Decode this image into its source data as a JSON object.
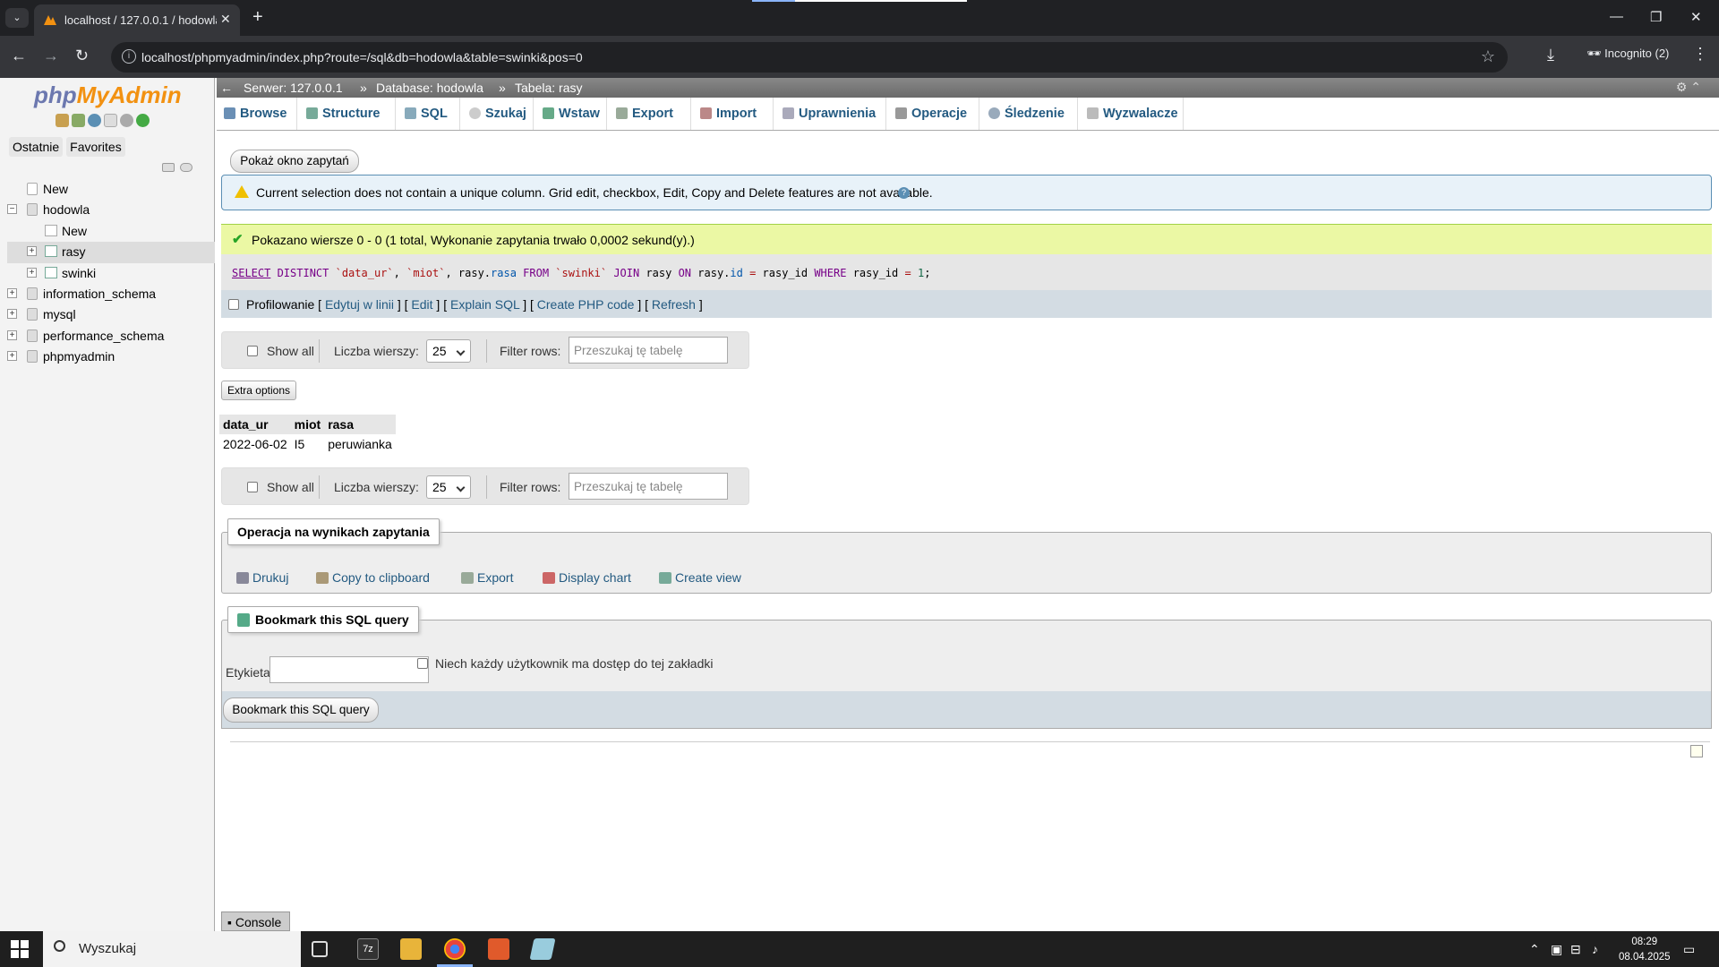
{
  "browser": {
    "tab_title": "localhost / 127.0.0.1 / hodowla",
    "url": "localhost/phpmyadmin/index.php?route=/sql&db=hodowla&table=swinki&pos=0",
    "incognito_label": "Incognito (2)"
  },
  "pma": {
    "logo_php": "php",
    "logo_myadmin": "MyAdmin",
    "left_tabs": [
      "Ostatnie",
      "Favorites"
    ],
    "tree": {
      "new_top": "New",
      "db_hodowla": "hodowla",
      "new_in_db": "New",
      "table_rasy": "rasy",
      "table_swinki": "swinki",
      "db_information_schema": "information_schema",
      "db_mysql": "mysql",
      "db_performance_schema": "performance_schema",
      "db_phpmyadmin": "phpmyadmin"
    },
    "breadcrumb": {
      "server": "Serwer: 127.0.0.1",
      "database": "Database: hodowla",
      "table": "Tabela: rasy"
    },
    "menu": [
      "Browse",
      "Structure",
      "SQL",
      "Szukaj",
      "Wstaw",
      "Export",
      "Import",
      "Uprawnienia",
      "Operacje",
      "Śledzenie",
      "Wyzwalacze"
    ],
    "show_query_button": "Pokaż okno zapytań",
    "notice_text": "Current selection does not contain a unique column. Grid edit, checkbox, Edit, Copy and Delete features are not available.",
    "success_text": "Pokazano wiersze 0 - 0 (1 total, Wykonanie zapytania trwało 0,0002 sekund(y).)",
    "sql": {
      "select": "SELECT",
      "distinct": " DISTINCT ",
      "col1": "`data_ur`",
      "comma1": ", ",
      "col2": "`miot`",
      "comma2": ", ",
      "col3a": "rasy.",
      "col3b": "rasa",
      "from": " FROM ",
      "tbl": "`swinki`",
      "join": " JOIN ",
      "tbl2": "rasy",
      "on": " ON ",
      "cond_a": "rasy.",
      "cond_b": "id",
      "eq": " = ",
      "cond_c": "rasy_id",
      "where": " WHERE ",
      "cond_d": "rasy_id",
      "eq2": " = ",
      "val": "1",
      "end": ";"
    },
    "actions": {
      "profiling": "Profilowanie",
      "inline_edit": "Edytuj w linii",
      "edit": "Edit",
      "explain": "Explain SQL",
      "php_code": "Create PHP code",
      "refresh": "Refresh"
    },
    "nav": {
      "show_all": "Show all",
      "rows_label": "Liczba wierszy:",
      "rows_value": "25",
      "filter_label": "Filter rows:",
      "filter_placeholder": "Przeszukaj tę tabelę"
    },
    "extra_options": "Extra options",
    "result": {
      "headers": [
        "data_ur",
        "miot",
        "rasa"
      ],
      "rows": [
        [
          "2022-06-02",
          "I5",
          "peruwianka"
        ]
      ]
    },
    "ops": {
      "legend": "Operacja na wynikach zapytania",
      "print": "Drukuj",
      "copy": "Copy to clipboard",
      "export": "Export",
      "chart": "Display chart",
      "view": "Create view"
    },
    "bookmark": {
      "legend": "Bookmark this SQL query",
      "label": "Etykieta:",
      "checkbox_text": "Niech każdy użytkownik ma dostęp do tej zakładki",
      "button": "Bookmark this SQL query"
    },
    "console": "Console"
  },
  "taskbar": {
    "search": "Wyszukaj",
    "time": "08:29",
    "date": "08.04.2025"
  }
}
